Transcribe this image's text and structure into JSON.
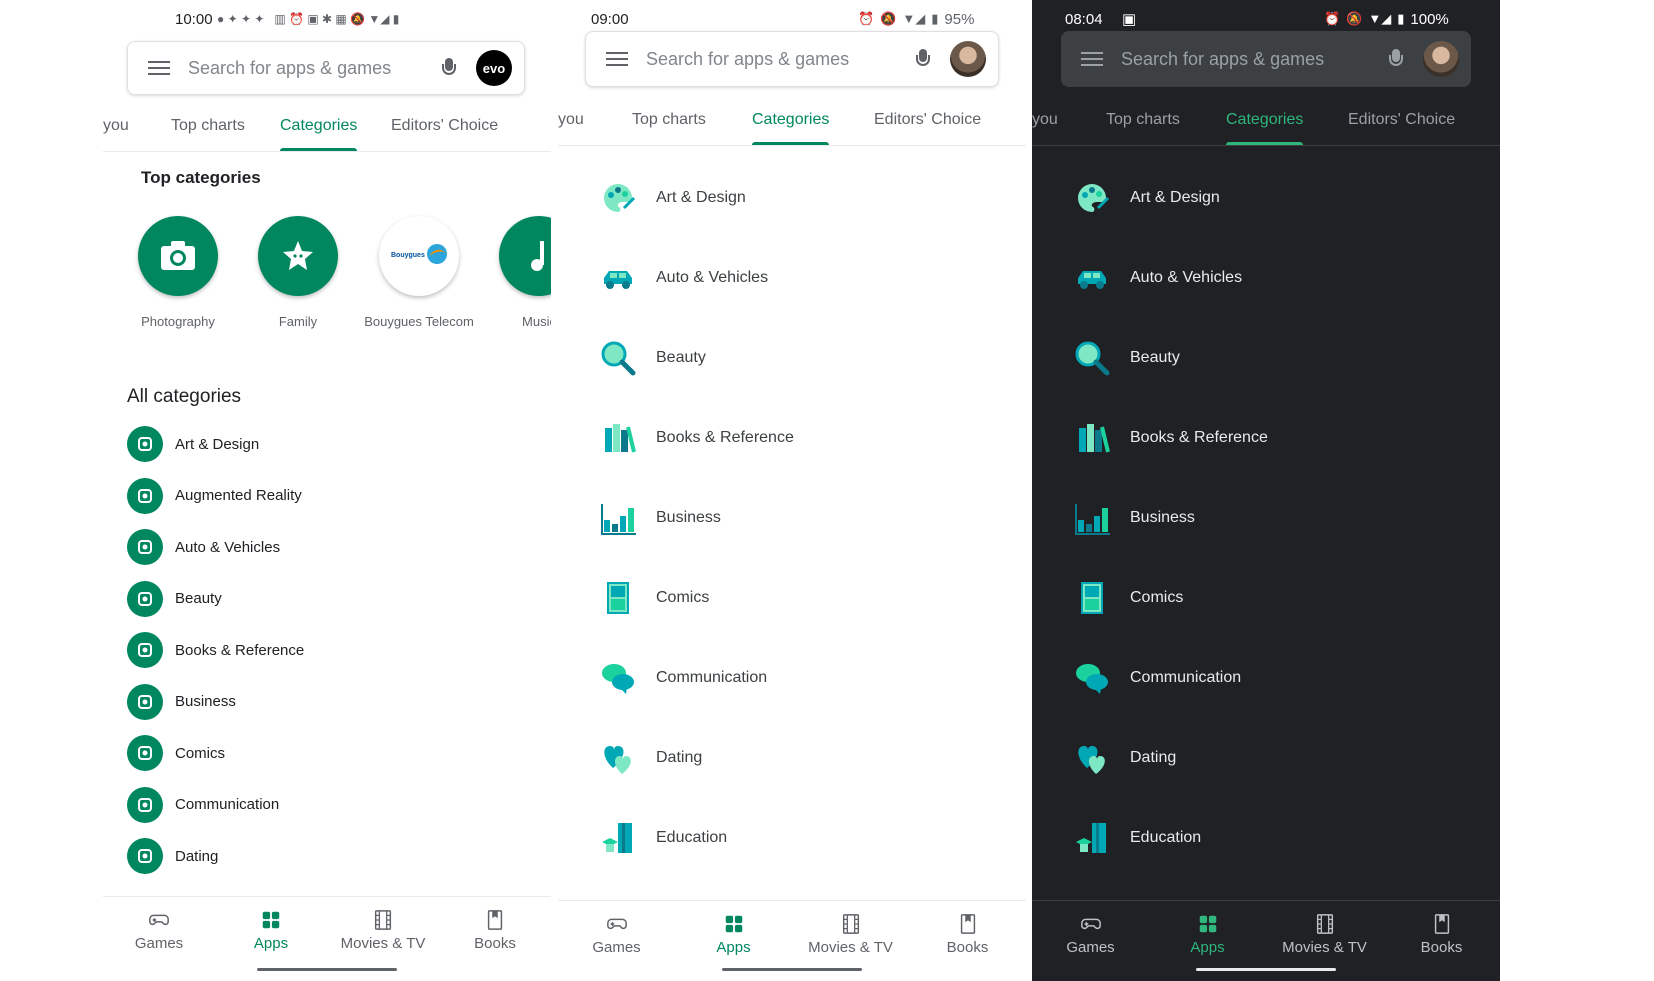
{
  "colors": {
    "accent": "#01875f",
    "accent_dark": "#2fb67c",
    "dark_bg": "#202124"
  },
  "panel1": {
    "status": {
      "time": "10:00"
    },
    "search": {
      "placeholder": "Search for apps & games",
      "avatar_text": "evo"
    },
    "tabs": [
      "you",
      "Top charts",
      "Categories",
      "Editors' Choice"
    ],
    "active_tab": "Categories",
    "top_categories_title": "Top categories",
    "top_categories": [
      {
        "label": "Photography",
        "icon": "camera-icon"
      },
      {
        "label": "Family",
        "icon": "star-icon"
      },
      {
        "label": "Bouygues Telecom",
        "icon": "bouygues-logo"
      },
      {
        "label": "Music",
        "icon": "music-note-icon"
      }
    ],
    "all_categories_title": "All categories",
    "all_categories": [
      "Art & Design",
      "Augmented Reality",
      "Auto & Vehicles",
      "Beauty",
      "Books & Reference",
      "Business",
      "Comics",
      "Communication",
      "Dating"
    ],
    "bottom_nav": [
      "Games",
      "Apps",
      "Movies & TV",
      "Books"
    ],
    "active_nav": "Apps"
  },
  "panel2": {
    "status": {
      "time": "09:00",
      "battery": "95%"
    },
    "search": {
      "placeholder": "Search for apps & games"
    },
    "tabs": [
      "you",
      "Top charts",
      "Categories",
      "Editors' Choice"
    ],
    "active_tab": "Categories",
    "categories": [
      "Art & Design",
      "Auto & Vehicles",
      "Beauty",
      "Books & Reference",
      "Business",
      "Comics",
      "Communication",
      "Dating",
      "Education"
    ],
    "bottom_nav": [
      "Games",
      "Apps",
      "Movies & TV",
      "Books"
    ],
    "active_nav": "Apps"
  },
  "panel3": {
    "status": {
      "time": "08:04",
      "battery": "100%"
    },
    "search": {
      "placeholder": "Search for apps & games"
    },
    "tabs": [
      "you",
      "Top charts",
      "Categories",
      "Editors' Choice"
    ],
    "active_tab": "Categories",
    "categories": [
      "Art & Design",
      "Auto & Vehicles",
      "Beauty",
      "Books & Reference",
      "Business",
      "Comics",
      "Communication",
      "Dating",
      "Education"
    ],
    "bottom_nav": [
      "Games",
      "Apps",
      "Movies & TV",
      "Books"
    ],
    "active_nav": "Apps"
  }
}
